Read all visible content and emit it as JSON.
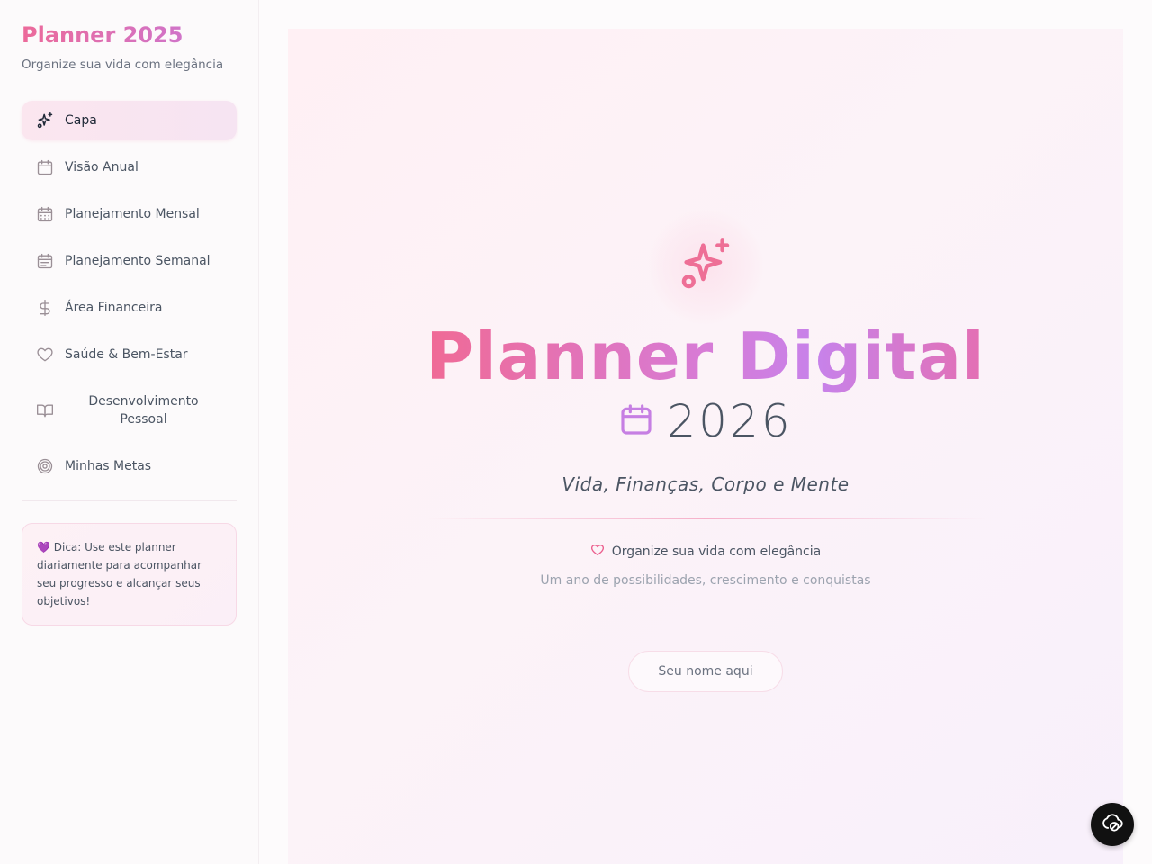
{
  "sidebar": {
    "title": "Planner 2025",
    "subtitle": "Organize sua vida com elegância",
    "items": [
      {
        "label": "Capa",
        "icon": "sparkles-icon",
        "active": true
      },
      {
        "label": "Visão Anual",
        "icon": "calendar-icon"
      },
      {
        "label": "Planejamento Mensal",
        "icon": "calendar-grid-icon"
      },
      {
        "label": "Planejamento Semanal",
        "icon": "calendar-week-icon"
      },
      {
        "label": "Área Financeira",
        "icon": "dollar-icon"
      },
      {
        "label": "Saúde & Bem-Estar",
        "icon": "heart-icon"
      },
      {
        "label": "Desenvolvimento Pessoal",
        "icon": "book-open-icon"
      },
      {
        "label": "Minhas Metas",
        "icon": "target-icon"
      }
    ],
    "tip": "💜 Dica: Use este planner diariamente para acompanhar seu progresso e alcançar seus objetivos!"
  },
  "cover": {
    "title": "Planner Digital",
    "year": "2026",
    "tagline": "Vida, Finanças, Corpo e Mente",
    "slogan": "Organize sua vida com elegância",
    "subslogan": "Um ano de possibilidades, crescimento e conquistas",
    "name_placeholder": "Seu nome aqui"
  },
  "colors": {
    "accent_pink": "#ec6a9a",
    "accent_purple": "#c777d8",
    "text": "#4b5563"
  }
}
